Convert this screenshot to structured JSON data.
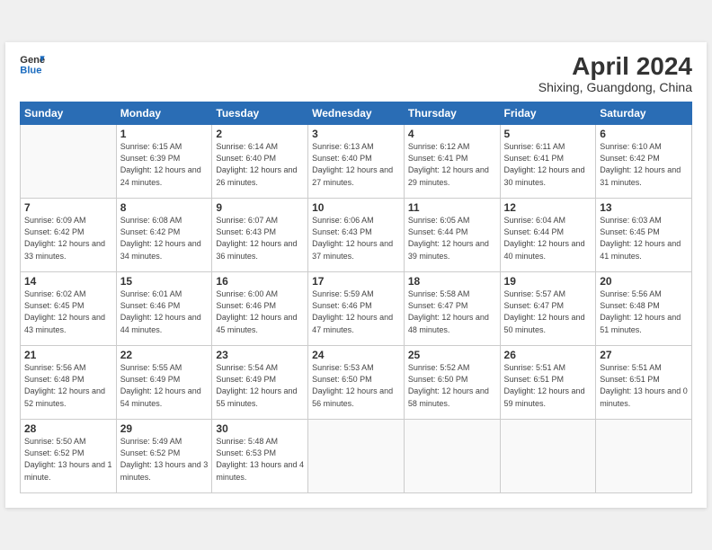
{
  "header": {
    "logo_line1": "General",
    "logo_line2": "Blue",
    "month": "April 2024",
    "location": "Shixing, Guangdong, China"
  },
  "weekdays": [
    "Sunday",
    "Monday",
    "Tuesday",
    "Wednesday",
    "Thursday",
    "Friday",
    "Saturday"
  ],
  "weeks": [
    [
      {
        "day": "",
        "sunrise": "",
        "sunset": "",
        "daylight": ""
      },
      {
        "day": "1",
        "sunrise": "6:15 AM",
        "sunset": "6:39 PM",
        "daylight": "12 hours and 24 minutes."
      },
      {
        "day": "2",
        "sunrise": "6:14 AM",
        "sunset": "6:40 PM",
        "daylight": "12 hours and 26 minutes."
      },
      {
        "day": "3",
        "sunrise": "6:13 AM",
        "sunset": "6:40 PM",
        "daylight": "12 hours and 27 minutes."
      },
      {
        "day": "4",
        "sunrise": "6:12 AM",
        "sunset": "6:41 PM",
        "daylight": "12 hours and 29 minutes."
      },
      {
        "day": "5",
        "sunrise": "6:11 AM",
        "sunset": "6:41 PM",
        "daylight": "12 hours and 30 minutes."
      },
      {
        "day": "6",
        "sunrise": "6:10 AM",
        "sunset": "6:42 PM",
        "daylight": "12 hours and 31 minutes."
      }
    ],
    [
      {
        "day": "7",
        "sunrise": "6:09 AM",
        "sunset": "6:42 PM",
        "daylight": "12 hours and 33 minutes."
      },
      {
        "day": "8",
        "sunrise": "6:08 AM",
        "sunset": "6:42 PM",
        "daylight": "12 hours and 34 minutes."
      },
      {
        "day": "9",
        "sunrise": "6:07 AM",
        "sunset": "6:43 PM",
        "daylight": "12 hours and 36 minutes."
      },
      {
        "day": "10",
        "sunrise": "6:06 AM",
        "sunset": "6:43 PM",
        "daylight": "12 hours and 37 minutes."
      },
      {
        "day": "11",
        "sunrise": "6:05 AM",
        "sunset": "6:44 PM",
        "daylight": "12 hours and 39 minutes."
      },
      {
        "day": "12",
        "sunrise": "6:04 AM",
        "sunset": "6:44 PM",
        "daylight": "12 hours and 40 minutes."
      },
      {
        "day": "13",
        "sunrise": "6:03 AM",
        "sunset": "6:45 PM",
        "daylight": "12 hours and 41 minutes."
      }
    ],
    [
      {
        "day": "14",
        "sunrise": "6:02 AM",
        "sunset": "6:45 PM",
        "daylight": "12 hours and 43 minutes."
      },
      {
        "day": "15",
        "sunrise": "6:01 AM",
        "sunset": "6:46 PM",
        "daylight": "12 hours and 44 minutes."
      },
      {
        "day": "16",
        "sunrise": "6:00 AM",
        "sunset": "6:46 PM",
        "daylight": "12 hours and 45 minutes."
      },
      {
        "day": "17",
        "sunrise": "5:59 AM",
        "sunset": "6:46 PM",
        "daylight": "12 hours and 47 minutes."
      },
      {
        "day": "18",
        "sunrise": "5:58 AM",
        "sunset": "6:47 PM",
        "daylight": "12 hours and 48 minutes."
      },
      {
        "day": "19",
        "sunrise": "5:57 AM",
        "sunset": "6:47 PM",
        "daylight": "12 hours and 50 minutes."
      },
      {
        "day": "20",
        "sunrise": "5:56 AM",
        "sunset": "6:48 PM",
        "daylight": "12 hours and 51 minutes."
      }
    ],
    [
      {
        "day": "21",
        "sunrise": "5:56 AM",
        "sunset": "6:48 PM",
        "daylight": "12 hours and 52 minutes."
      },
      {
        "day": "22",
        "sunrise": "5:55 AM",
        "sunset": "6:49 PM",
        "daylight": "12 hours and 54 minutes."
      },
      {
        "day": "23",
        "sunrise": "5:54 AM",
        "sunset": "6:49 PM",
        "daylight": "12 hours and 55 minutes."
      },
      {
        "day": "24",
        "sunrise": "5:53 AM",
        "sunset": "6:50 PM",
        "daylight": "12 hours and 56 minutes."
      },
      {
        "day": "25",
        "sunrise": "5:52 AM",
        "sunset": "6:50 PM",
        "daylight": "12 hours and 58 minutes."
      },
      {
        "day": "26",
        "sunrise": "5:51 AM",
        "sunset": "6:51 PM",
        "daylight": "12 hours and 59 minutes."
      },
      {
        "day": "27",
        "sunrise": "5:51 AM",
        "sunset": "6:51 PM",
        "daylight": "13 hours and 0 minutes."
      }
    ],
    [
      {
        "day": "28",
        "sunrise": "5:50 AM",
        "sunset": "6:52 PM",
        "daylight": "13 hours and 1 minute."
      },
      {
        "day": "29",
        "sunrise": "5:49 AM",
        "sunset": "6:52 PM",
        "daylight": "13 hours and 3 minutes."
      },
      {
        "day": "30",
        "sunrise": "5:48 AM",
        "sunset": "6:53 PM",
        "daylight": "13 hours and 4 minutes."
      },
      {
        "day": "",
        "sunrise": "",
        "sunset": "",
        "daylight": ""
      },
      {
        "day": "",
        "sunrise": "",
        "sunset": "",
        "daylight": ""
      },
      {
        "day": "",
        "sunrise": "",
        "sunset": "",
        "daylight": ""
      },
      {
        "day": "",
        "sunrise": "",
        "sunset": "",
        "daylight": ""
      }
    ]
  ]
}
